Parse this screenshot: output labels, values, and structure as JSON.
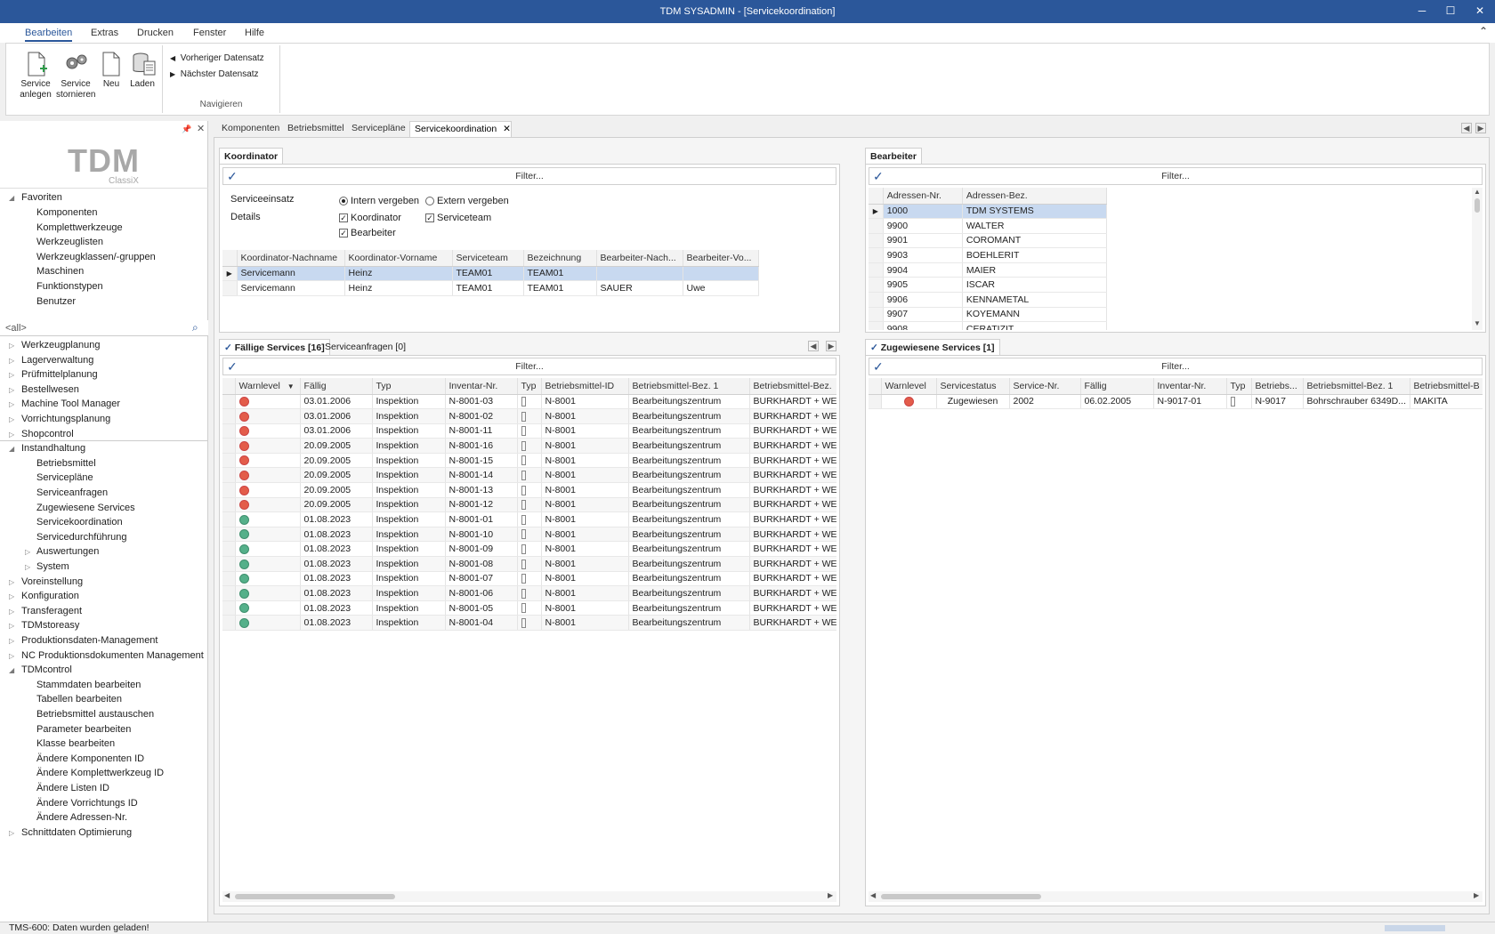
{
  "window": {
    "title": "TDM SYSADMIN - [Servicekoordination]"
  },
  "menu": [
    "Bearbeiten",
    "Extras",
    "Drucken",
    "Fenster",
    "Hilfe"
  ],
  "ribbon": {
    "buttons": [
      "Service anlegen",
      "Service stornieren",
      "Neu",
      "Laden"
    ],
    "nav_prev": "Vorheriger Datensatz",
    "nav_next": "Nächster Datensatz",
    "group_label": "Navigieren"
  },
  "left": {
    "logo": "TDM",
    "logo_sub": "ClassiX",
    "favoriten": "Favoriten",
    "fav_items": [
      "Komponenten",
      "Komplettwerkzeuge",
      "Werkzeuglisten",
      "Werkzeugklassen/-gruppen",
      "Maschinen",
      "Funktionstypen",
      "Benutzer"
    ],
    "search_placeholder": "<all>",
    "tree": [
      "Werkzeugplanung",
      "Lagerverwaltung",
      "Prüfmittelplanung",
      "Bestellwesen",
      "Machine Tool Manager",
      "Vorrichtungsplanung",
      "Shopcontrol",
      "Instandhaltung",
      "Betriebsmittel",
      "Servicepläne",
      "Serviceanfragen",
      "Zugewiesene Services",
      "Servicekoordination",
      "Servicedurchführung",
      "Auswertungen",
      "System",
      "Voreinstellung",
      "Konfiguration",
      "Transferagent",
      "TDMstoreasy",
      "Produktionsdaten-Management",
      "NC Produktionsdokumenten Management",
      "TDMcontrol",
      "Stammdaten bearbeiten",
      "Tabellen bearbeiten",
      "Betriebsmittel austauschen",
      "Parameter bearbeiten",
      "Klasse bearbeiten",
      "Ändere Komponenten ID",
      "Ändere Komplettwerkzeug ID",
      "Ändere Listen ID",
      "Ändere Vorrichtungs ID",
      "Ändere Adressen-Nr.",
      "Schnittdaten Optimierung"
    ]
  },
  "doctabs": [
    "Komponenten",
    "Betriebsmittel",
    "Servicepläne",
    "Servicekoordination"
  ],
  "koordinator": {
    "tab": "Koordinator",
    "filter": "Filter...",
    "serviceeinsatz_label": "Serviceeinsatz",
    "details_label": "Details",
    "radio_intern": "Intern vergeben",
    "radio_extern": "Extern vergeben",
    "cb_koordinator": "Koordinator",
    "cb_serviceteam": "Serviceteam",
    "cb_bearbeiter": "Bearbeiter",
    "columns": [
      "Koordinator-Nachname",
      "Koordinator-Vorname",
      "Serviceteam",
      "Bezeichnung",
      "Bearbeiter-Nach...",
      "Bearbeiter-Vo..."
    ],
    "rows": [
      [
        "Servicemann",
        "Heinz",
        "TEAM01",
        "TEAM01",
        "",
        ""
      ],
      [
        "Servicemann",
        "Heinz",
        "TEAM01",
        "TEAM01",
        "SAUER",
        "Uwe"
      ]
    ]
  },
  "bearbeiter": {
    "tab": "Bearbeiter",
    "filter": "Filter...",
    "columns": [
      "Adressen-Nr.",
      "Adressen-Bez."
    ],
    "rows": [
      [
        "1000",
        "TDM SYSTEMS"
      ],
      [
        "9900",
        "WALTER"
      ],
      [
        "9901",
        "COROMANT"
      ],
      [
        "9903",
        "BOEHLERIT"
      ],
      [
        "9904",
        "MAIER"
      ],
      [
        "9905",
        "ISCAR"
      ],
      [
        "9906",
        "KENNAMETAL"
      ],
      [
        "9907",
        "KOYEMANN"
      ],
      [
        "9908",
        "CERATIZIT"
      ]
    ]
  },
  "faellig": {
    "tab": "Fällige Services [16]",
    "tab2": "Serviceanfragen [0]",
    "filter": "Filter...",
    "columns": [
      "Warnlevel",
      "Fällig",
      "Typ",
      "Inventar-Nr.",
      "Typ",
      "Betriebsmittel-ID",
      "Betriebsmittel-Bez. 1",
      "Betriebsmittel-Bez."
    ],
    "rows": [
      {
        "level": "red",
        "date": "03.01.2006",
        "typ": "Inspektion",
        "inv": "N-8001-03",
        "id": "N-8001",
        "bez1": "Bearbeitungszentrum",
        "bez2": "BURKHARDT + WEB"
      },
      {
        "level": "red",
        "date": "03.01.2006",
        "typ": "Inspektion",
        "inv": "N-8001-02",
        "id": "N-8001",
        "bez1": "Bearbeitungszentrum",
        "bez2": "BURKHARDT + WEB"
      },
      {
        "level": "red",
        "date": "03.01.2006",
        "typ": "Inspektion",
        "inv": "N-8001-11",
        "id": "N-8001",
        "bez1": "Bearbeitungszentrum",
        "bez2": "BURKHARDT + WEB"
      },
      {
        "level": "red",
        "date": "20.09.2005",
        "typ": "Inspektion",
        "inv": "N-8001-16",
        "id": "N-8001",
        "bez1": "Bearbeitungszentrum",
        "bez2": "BURKHARDT + WEB"
      },
      {
        "level": "red",
        "date": "20.09.2005",
        "typ": "Inspektion",
        "inv": "N-8001-15",
        "id": "N-8001",
        "bez1": "Bearbeitungszentrum",
        "bez2": "BURKHARDT + WEB"
      },
      {
        "level": "red",
        "date": "20.09.2005",
        "typ": "Inspektion",
        "inv": "N-8001-14",
        "id": "N-8001",
        "bez1": "Bearbeitungszentrum",
        "bez2": "BURKHARDT + WEB"
      },
      {
        "level": "red",
        "date": "20.09.2005",
        "typ": "Inspektion",
        "inv": "N-8001-13",
        "id": "N-8001",
        "bez1": "Bearbeitungszentrum",
        "bez2": "BURKHARDT + WEB"
      },
      {
        "level": "red",
        "date": "20.09.2005",
        "typ": "Inspektion",
        "inv": "N-8001-12",
        "id": "N-8001",
        "bez1": "Bearbeitungszentrum",
        "bez2": "BURKHARDT + WEB"
      },
      {
        "level": "green",
        "date": "01.08.2023",
        "typ": "Inspektion",
        "inv": "N-8001-01",
        "id": "N-8001",
        "bez1": "Bearbeitungszentrum",
        "bez2": "BURKHARDT + WEB"
      },
      {
        "level": "green",
        "date": "01.08.2023",
        "typ": "Inspektion",
        "inv": "N-8001-10",
        "id": "N-8001",
        "bez1": "Bearbeitungszentrum",
        "bez2": "BURKHARDT + WEB"
      },
      {
        "level": "green",
        "date": "01.08.2023",
        "typ": "Inspektion",
        "inv": "N-8001-09",
        "id": "N-8001",
        "bez1": "Bearbeitungszentrum",
        "bez2": "BURKHARDT + WEB"
      },
      {
        "level": "green",
        "date": "01.08.2023",
        "typ": "Inspektion",
        "inv": "N-8001-08",
        "id": "N-8001",
        "bez1": "Bearbeitungszentrum",
        "bez2": "BURKHARDT + WEB"
      },
      {
        "level": "green",
        "date": "01.08.2023",
        "typ": "Inspektion",
        "inv": "N-8001-07",
        "id": "N-8001",
        "bez1": "Bearbeitungszentrum",
        "bez2": "BURKHARDT + WEB"
      },
      {
        "level": "green",
        "date": "01.08.2023",
        "typ": "Inspektion",
        "inv": "N-8001-06",
        "id": "N-8001",
        "bez1": "Bearbeitungszentrum",
        "bez2": "BURKHARDT + WEB"
      },
      {
        "level": "green",
        "date": "01.08.2023",
        "typ": "Inspektion",
        "inv": "N-8001-05",
        "id": "N-8001",
        "bez1": "Bearbeitungszentrum",
        "bez2": "BURKHARDT + WEB"
      },
      {
        "level": "green",
        "date": "01.08.2023",
        "typ": "Inspektion",
        "inv": "N-8001-04",
        "id": "N-8001",
        "bez1": "Bearbeitungszentrum",
        "bez2": "BURKHARDT + WEB"
      }
    ]
  },
  "zugewiesen": {
    "tab": "Zugewiesene Services [1]",
    "filter": "Filter...",
    "columns": [
      "Warnlevel",
      "Servicestatus",
      "Service-Nr.",
      "Fällig",
      "Inventar-Nr.",
      "Typ",
      "Betriebs...",
      "Betriebsmittel-Bez. 1",
      "Betriebsmittel-B"
    ],
    "rows": [
      {
        "level": "red",
        "status": "Zugewiesen",
        "nr": "2002",
        "date": "06.02.2005",
        "inv": "N-9017-01",
        "id": "N-9017",
        "bez1": "Bohrschrauber 6349D...",
        "bez2": "MAKITA"
      }
    ]
  },
  "status": {
    "text": "TMS-600: Daten wurden geladen!"
  },
  "colors": {
    "accent": "#2b579a",
    "warn_red": "#e35c4a",
    "ok_green": "#55b08a",
    "selection": "#c8d9f0"
  }
}
